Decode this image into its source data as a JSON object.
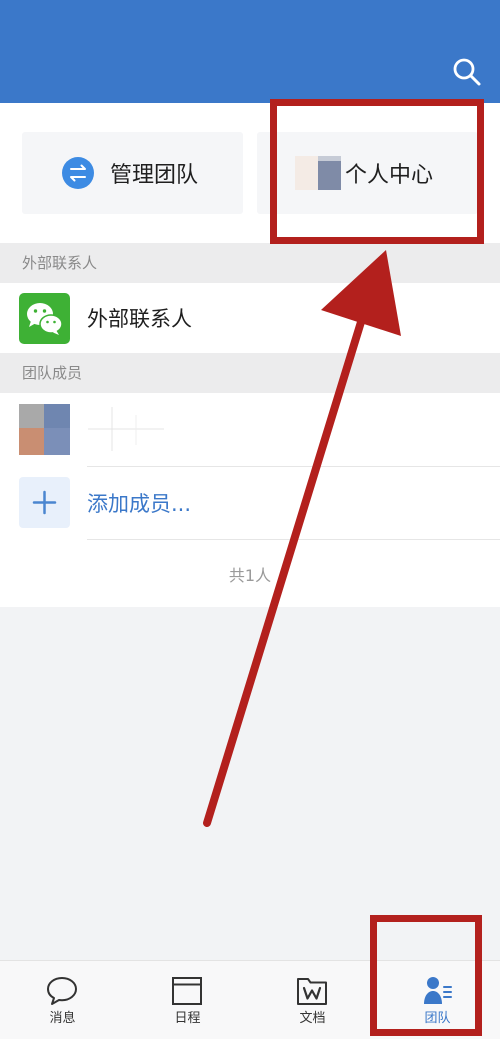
{
  "header": {
    "search_icon": "search-icon"
  },
  "quick_actions": {
    "manage_team": {
      "label": "管理团队",
      "icon": "swap-settings-icon"
    },
    "personal_center": {
      "label": "个人中心",
      "icon": "avatar"
    }
  },
  "external_contacts": {
    "section_title": "外部联系人",
    "item_label": "外部联系人",
    "item_icon": "wechat-icon"
  },
  "team_members": {
    "section_title": "团队成员",
    "add_member_label": "添加成员...",
    "add_member_icon": "plus-icon",
    "count_text": "共1人"
  },
  "tab_bar": {
    "tabs": [
      {
        "label": "消息",
        "icon": "chat-bubble-icon",
        "active": false
      },
      {
        "label": "日程",
        "icon": "calendar-icon",
        "active": false
      },
      {
        "label": "文档",
        "icon": "document-folder-icon",
        "active": false
      },
      {
        "label": "团队",
        "icon": "team-icon",
        "active": true
      }
    ]
  },
  "colors": {
    "header_bg": "#3b78c9",
    "accent": "#3b78c9",
    "wechat_green": "#3eb135",
    "annotation_red": "#b3201d",
    "page_bg": "#f2f3f5"
  }
}
